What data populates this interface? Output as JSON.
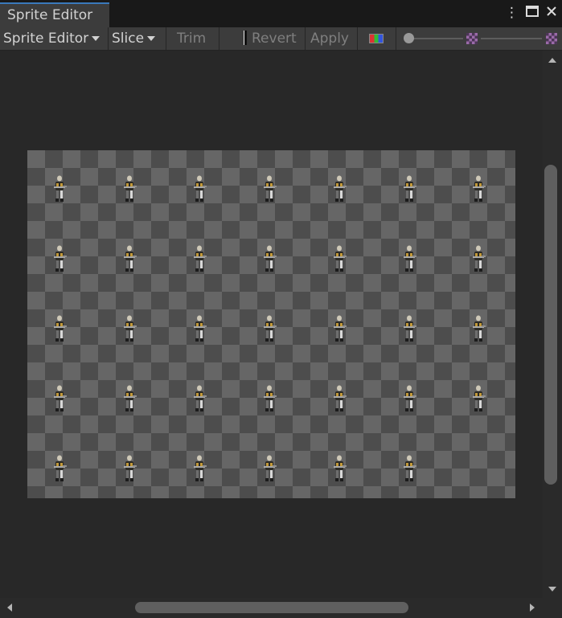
{
  "window": {
    "tab_title": "Sprite Editor",
    "menu_icon": "kebab-menu-icon",
    "maximize_icon": "maximize-icon",
    "close_icon": "close-icon"
  },
  "toolbar": {
    "mode_label": "Sprite Editor",
    "slice_label": "Slice",
    "trim_label": "Trim",
    "revert_label": "Revert",
    "apply_label": "Apply",
    "color_channel_icon": "rgb-channel-icon",
    "zoom_slider_value": 0.0,
    "mip_slider_value": 0.0,
    "mip_low_icon": "mip-low-icon",
    "mip_high_icon": "mip-high-icon"
  },
  "sheet": {
    "rows": [
      7,
      7,
      7,
      7,
      6
    ],
    "sprite_icon": "soldier-sprite"
  },
  "colors": {
    "background": "#282828",
    "toolbar": "#3c3c3c",
    "tab_accent": "#3a79bb",
    "checker_light": "#666666",
    "checker_dark": "#4d4d4d"
  }
}
